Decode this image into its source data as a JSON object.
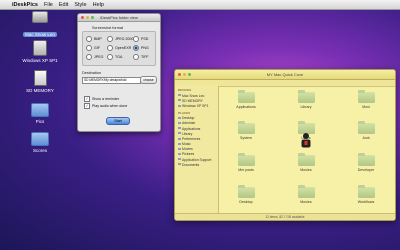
{
  "menubar": {
    "apple": "",
    "items": [
      "iDeskPics",
      "File",
      "Edit",
      "Style",
      "Help"
    ]
  },
  "desktop_icons": [
    {
      "label": "Mac Snow Leo",
      "icon": "hard-drive-icon",
      "selected": true
    },
    {
      "label": "Windows XP SP1",
      "icon": "drive-icon",
      "selected": false
    },
    {
      "label": "SD MEMORY",
      "icon": "sd-card-icon",
      "selected": false
    },
    {
      "label": "Pics",
      "icon": "folder-icon",
      "selected": false
    },
    {
      "label": "Scores",
      "icon": "folder-icon",
      "selected": false
    }
  ],
  "dialog": {
    "title": "iDeskPics folder view",
    "format_label": "Screenshot format",
    "formats": [
      {
        "label": "BMP",
        "selected": false
      },
      {
        "label": "JPEG 2000",
        "selected": false
      },
      {
        "label": "PSD",
        "selected": false
      },
      {
        "label": "GIF",
        "selected": false
      },
      {
        "label": "OpenEXR",
        "selected": false
      },
      {
        "label": "PNG",
        "selected": true
      },
      {
        "label": "JPEG",
        "selected": false
      },
      {
        "label": "TGA",
        "selected": false
      },
      {
        "label": "TIFF",
        "selected": false
      }
    ],
    "destination_label": "Destination",
    "destination_value": "SD MEMORY/My deskpix/fold",
    "choose_label": "choose",
    "checkboxes": [
      {
        "label": "Show a reminder",
        "checked": true
      },
      {
        "label": "Play audio when done",
        "checked": true
      }
    ],
    "start_label": "Start"
  },
  "finder": {
    "title": "MY Mac Quick Cove",
    "sidebar": {
      "devices_header": "DEVICES",
      "devices": [
        "Mac Snow Leo",
        "SD MEMORY",
        "Windows XP SP1"
      ],
      "places_header": "PLACES",
      "places": [
        "Desktop",
        "Adminstr",
        "Applications",
        "Library",
        "Preferences",
        "Music",
        "Movies",
        "Pictures",
        "Application Support",
        "Documents"
      ]
    },
    "items": [
      {
        "name": "Applications"
      },
      {
        "name": "Library"
      },
      {
        "name": "Movi"
      },
      {
        "name": "System"
      },
      {
        "name": "Users"
      },
      {
        "name": "Junk"
      },
      {
        "name": "Mm posts"
      },
      {
        "name": "Movies"
      },
      {
        "name": "Developer"
      },
      {
        "name": "Desktop"
      },
      {
        "name": "Movies"
      },
      {
        "name": "Workflows"
      }
    ],
    "status": "12 items, 82.7 GB available"
  },
  "colors": {
    "finder_bg": "#f7f1a8",
    "start_button": "#4b86dd"
  }
}
